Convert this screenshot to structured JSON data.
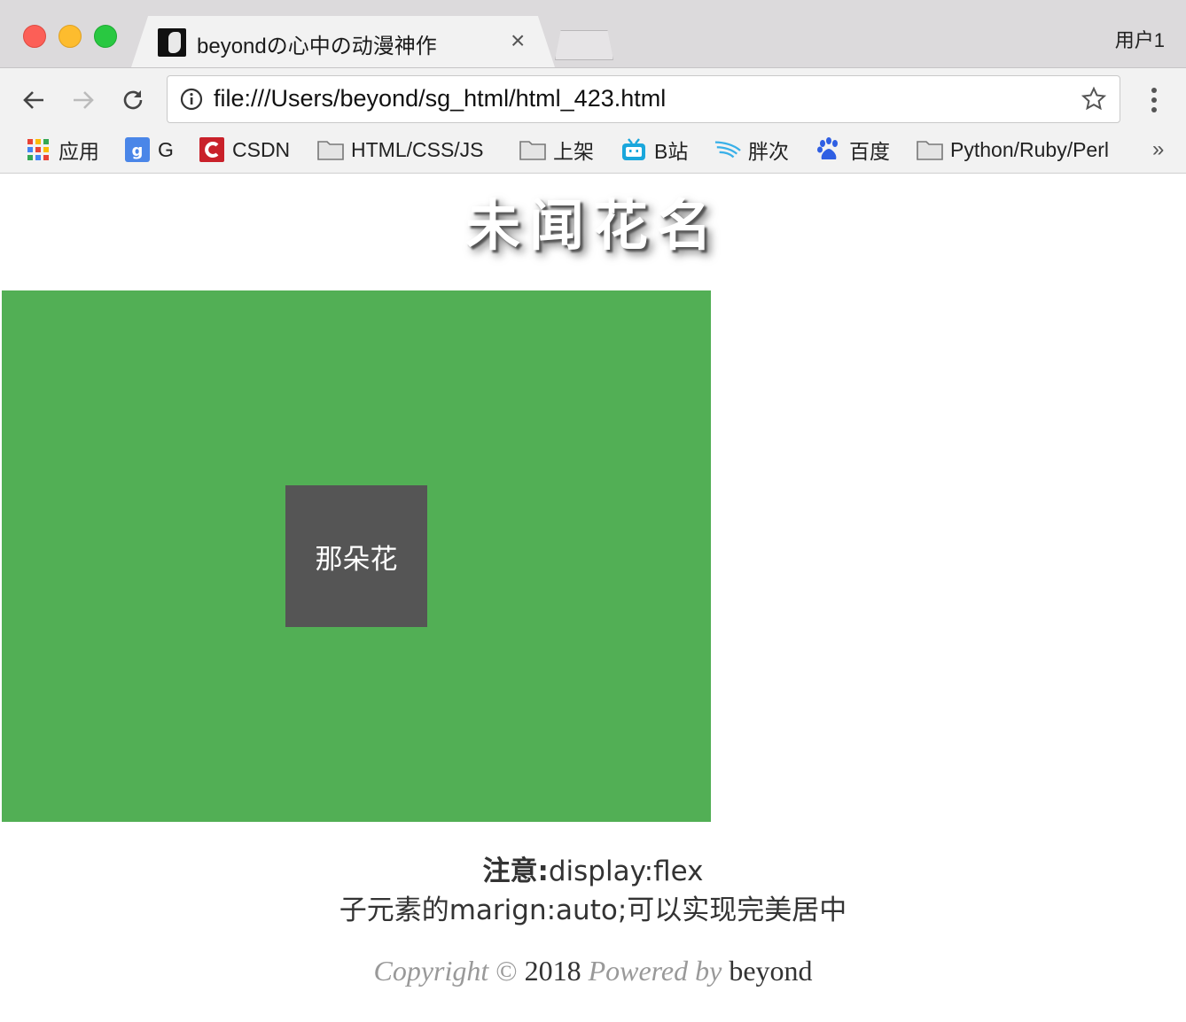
{
  "tab": {
    "title": "beyondの心中の动漫神作",
    "close_glyph": "×"
  },
  "profile": {
    "label": "用户1"
  },
  "address_bar": {
    "url": "file:///Users/beyond/sg_html/html_423.html"
  },
  "bookmarks": [
    {
      "label": "应用",
      "icon": "apps-grid-icon"
    },
    {
      "label": "G",
      "icon": "google-icon"
    },
    {
      "label": "CSDN",
      "icon": "csdn-icon"
    },
    {
      "label": "HTML/CSS/JS",
      "icon": "folder-icon"
    },
    {
      "label": "上架",
      "icon": "folder-icon"
    },
    {
      "label": "B站",
      "icon": "bilibili-icon"
    },
    {
      "label": "胖次",
      "icon": "wing-icon"
    },
    {
      "label": "百度",
      "icon": "baidu-icon"
    },
    {
      "label": "Python/Ruby/Perl",
      "icon": "folder-icon"
    }
  ],
  "bookmarks_more": "»",
  "page": {
    "title": "未闻花名",
    "centered_box_label": "那朵花",
    "note_bold": "注意:",
    "note_rest": "display:flex",
    "note_line2": "子元素的marign:auto;可以实现完美居中",
    "copyright_prefix": "Copyright",
    "copyright_symbol": "©",
    "copyright_year": "2018",
    "copyright_powered": "Powered by",
    "copyright_author": "beyond"
  },
  "colors": {
    "flex_container": "#52af55",
    "centered_box": "#555555",
    "traffic_close": "#fc5f57",
    "traffic_min": "#fdbc2e",
    "traffic_max": "#29c841"
  }
}
